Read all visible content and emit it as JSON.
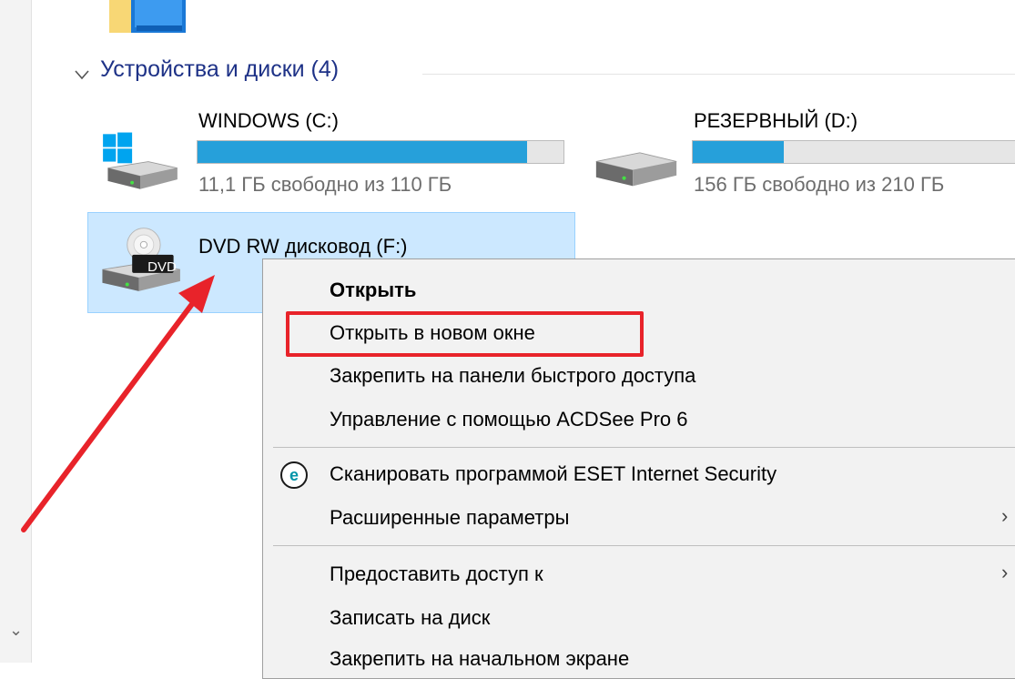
{
  "group": {
    "header": "Устройства и диски (4)"
  },
  "drives": [
    {
      "name": "WINDOWS (C:)",
      "free_text": "11,1 ГБ свободно из 110 ГБ",
      "used_fraction": 0.9,
      "type": "hdd-windows"
    },
    {
      "name": "РЕЗЕРВНЫЙ (D:)",
      "free_text": "156 ГБ свободно из 210 ГБ",
      "used_fraction": 0.257,
      "type": "hdd"
    },
    {
      "name": "DVD RW дисковод (F:)",
      "badge": "DVD",
      "type": "dvd",
      "selected": true
    }
  ],
  "context_menu": {
    "items": [
      {
        "label": "Открыть",
        "bold": true
      },
      {
        "label": "Открыть в новом окне",
        "highlighted": true
      },
      {
        "label": "Закрепить на панели быстрого доступа"
      },
      {
        "label": "Управление с помощью ACDSee Pro 6"
      },
      {
        "label": "Сканировать программой ESET Internet Security",
        "icon": "eset-icon"
      },
      {
        "label": "Расширенные параметры",
        "submenu": true
      },
      {
        "label": "Предоставить доступ к",
        "submenu": true
      },
      {
        "label": "Записать на диск"
      },
      {
        "label": "Закрепить на начальном экране"
      }
    ]
  },
  "colors": {
    "accent": "#26a0da",
    "selection": "#cce8ff",
    "annotation": "#e8232a",
    "group_header": "#1e3287"
  }
}
